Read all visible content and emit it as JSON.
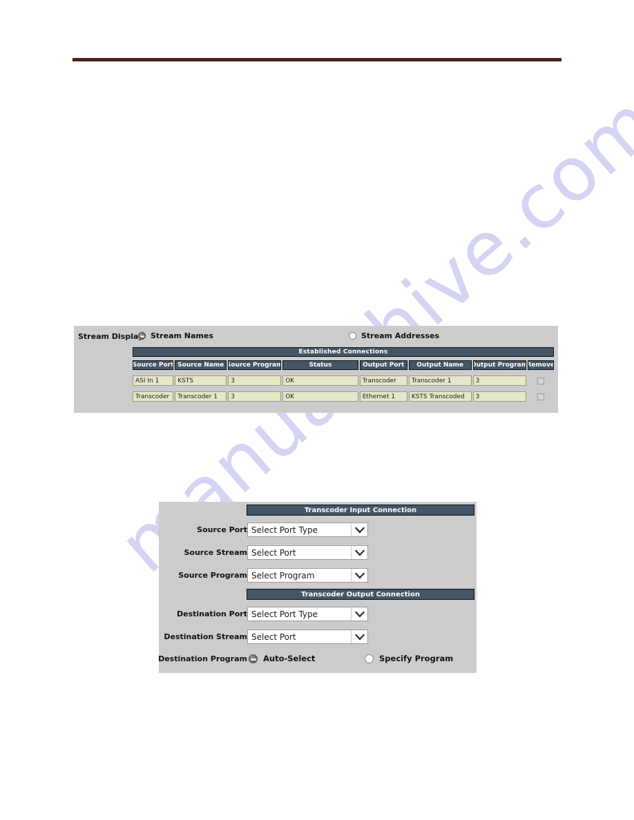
{
  "page": {
    "watermark": "manualshive.com",
    "rule_color": "#4a1f1c"
  },
  "connections_panel": {
    "stream_display_label": "Stream Display",
    "radios": [
      {
        "label": "Stream Names",
        "checked": true
      },
      {
        "label": "Stream Addresses",
        "checked": false
      }
    ],
    "table_title": "Established Connections",
    "columns": [
      "Source Port",
      "Source Name",
      "Source Program",
      "Status",
      "Output Port",
      "Output Name",
      "Output Program",
      "Remove"
    ],
    "rows": [
      {
        "source_port": "ASI In 1",
        "source_name": "KSTS",
        "source_program": "3",
        "status": "OK",
        "output_port": "Transcoder",
        "output_name": "Transcoder 1",
        "output_program": "3",
        "remove_checked": false
      },
      {
        "source_port": "Transcoder",
        "source_name": "Transcoder 1",
        "source_program": "3",
        "status": "OK",
        "output_port": "Ethernet 1",
        "output_name": "KSTS Transcoded",
        "output_program": "3",
        "remove_checked": false
      }
    ]
  },
  "transcoder_panel": {
    "input_section_title": "Transcoder Input Connection",
    "output_section_title": "Transcoder Output Connection",
    "fields": {
      "source_port": {
        "label": "Source Port",
        "value": "Select Port Type"
      },
      "source_stream": {
        "label": "Source Stream",
        "value": "Select Port"
      },
      "source_program": {
        "label": "Source Program",
        "value": "Select Program"
      },
      "dest_port": {
        "label": "Destination Port",
        "value": "Select Port Type"
      },
      "dest_stream": {
        "label": "Destination Stream",
        "value": "Select Port"
      },
      "dest_program": {
        "label": "Destination Program"
      }
    },
    "dest_program_options": [
      {
        "label": "Auto-Select",
        "checked": true
      },
      {
        "label": "Specify Program",
        "checked": false
      }
    ]
  },
  "colors": {
    "panel_bg": "#cccccc",
    "header_bar": "#445566",
    "field_bg": "#e6e6c8",
    "accent_rule": "#4a1f1c",
    "watermark": "#ccccf0"
  }
}
